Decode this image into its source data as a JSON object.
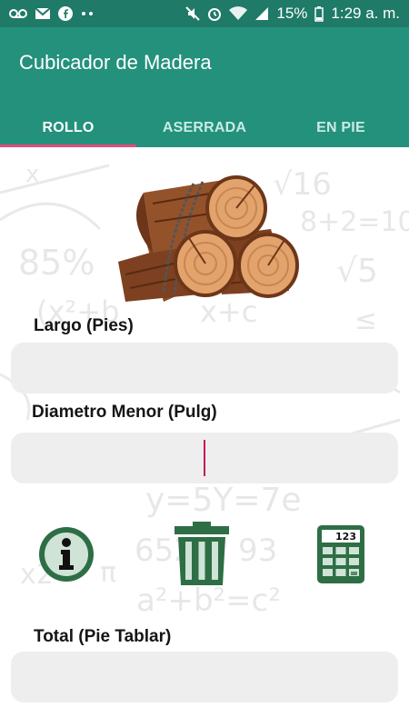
{
  "status_bar": {
    "battery": "15%",
    "time": "1:29 a. m.",
    "left_icons": [
      "voicemail-icon",
      "mail-icon",
      "facebook-icon",
      "more-dots-icon"
    ],
    "right_icons": [
      "mute-icon",
      "alarm-icon",
      "wifi-icon",
      "signal-icon",
      "battery-icon"
    ]
  },
  "app": {
    "title": "Cubicador de Madera",
    "colors": {
      "primary": "#24917c",
      "primary_dark": "#1f7a68",
      "accent": "#e44b7a",
      "icon_green": "#2e6e45"
    }
  },
  "tabs": [
    {
      "label": "ROLLO",
      "active": true
    },
    {
      "label": "ASERRADA",
      "active": false
    },
    {
      "label": "EN PIE",
      "active": false
    }
  ],
  "form": {
    "largo": {
      "label": "Largo (Pies)",
      "value": ""
    },
    "diametro": {
      "label": "Diametro Menor (Pulg)",
      "value": ""
    },
    "total": {
      "label": "Total (Pie Tablar)",
      "value": ""
    }
  },
  "actions": {
    "info_icon": "info-icon",
    "clear_icon": "trash-icon",
    "calc_icon": "calculator-icon",
    "calculator_display": "123"
  },
  "background_text": [
    "√16",
    "x",
    "8+2=10",
    "85%",
    "√5",
    "(x²+b",
    "x+c",
    "≤",
    "y=5Y=7e",
    "x2",
    "π",
    "652",
    "93",
    "a²+b²=c²"
  ]
}
